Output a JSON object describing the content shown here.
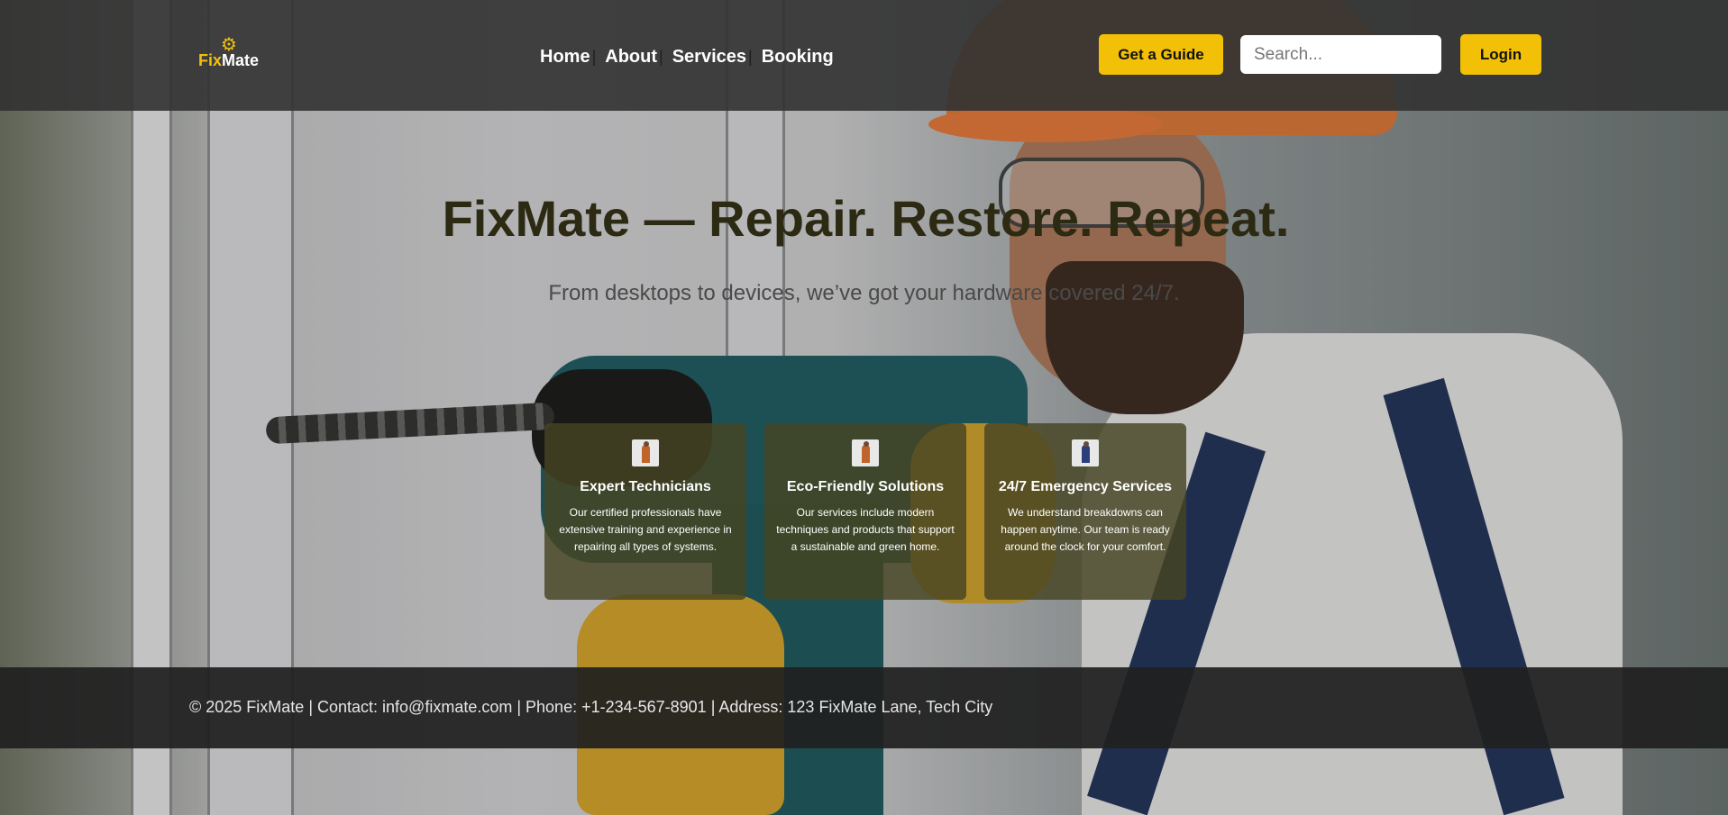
{
  "brand": {
    "name_part1": "Fix",
    "name_part2": "Mate",
    "logo_icon": "gear-wrench-icon",
    "accent_color": "#f2c006"
  },
  "nav": {
    "items": [
      {
        "label": "Home"
      },
      {
        "label": "About"
      },
      {
        "label": "Services"
      },
      {
        "label": "Booking"
      }
    ],
    "separator": "|"
  },
  "header": {
    "guide_button": "Get a Guide",
    "search_placeholder": "Search...",
    "login_button": "Login"
  },
  "hero": {
    "title": "FixMate — Repair. Restore. Repeat.",
    "subtitle": "From desktops to devices, we’ve got your hardware covered 24/7."
  },
  "features": [
    {
      "icon": "technician-icon",
      "title": "Expert Technicians",
      "description": "Our certified professionals have extensive training and experience in repairing all types of systems."
    },
    {
      "icon": "technician-icon",
      "title": "Eco-Friendly Solutions",
      "description": "Our services include modern techniques and products that support a sustainable and green home."
    },
    {
      "icon": "technician-icon",
      "title": "24/7 Emergency Services",
      "description": "We understand breakdowns can happen anytime. Our team is ready around the clock for your comfort."
    }
  ],
  "footer": {
    "text": "© 2025 FixMate | Contact: info@fixmate.com | Phone: +1-234-567-8901 | Address: 123 FixMate Lane, Tech City"
  }
}
